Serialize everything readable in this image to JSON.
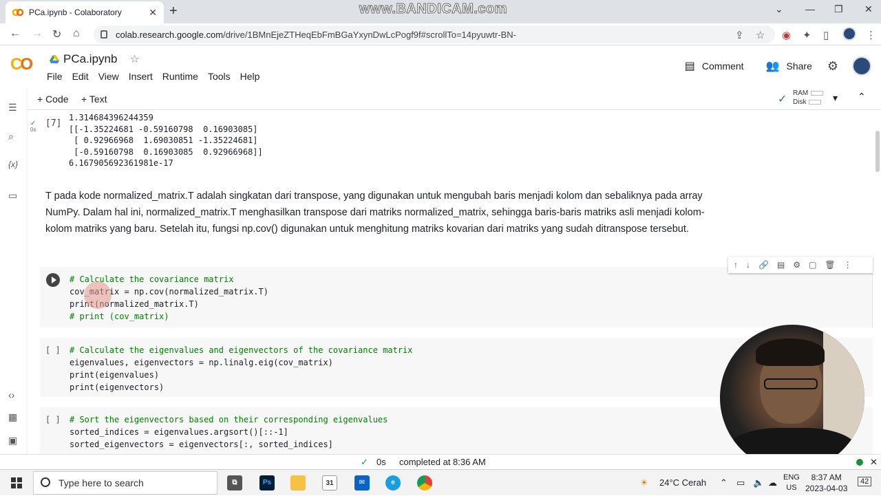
{
  "browser": {
    "tab_title": "PCa.ipynb - Colaboratory",
    "new_tab": "+",
    "url_host": "colab.research.google.com",
    "url_path": "/drive/1BMnEjeZTHeqEbFmBGaYxynDwLcPogf9f#scrollTo=14pyuwtr-BN-",
    "watermark": "www.BANDICAM.com"
  },
  "colab": {
    "logo": "CO",
    "notebook_title": "PCa.ipynb",
    "menu": [
      "File",
      "Edit",
      "View",
      "Insert",
      "Runtime",
      "Tools",
      "Help"
    ],
    "comment_label": "Comment",
    "share_label": "Share",
    "add_code": "+ Code",
    "add_text": "+ Text",
    "ram_label": "RAM",
    "disk_label": "Disk"
  },
  "cells": {
    "output_cell": {
      "exec_count": "[7]",
      "exec_time": "0s",
      "output": "1.314684396244359\n[[-1.35224681 -0.59160798  0.16903085]\n [ 0.92966968  1.69030851 -1.35224681]\n [-0.59160798  0.16903085  0.92966968]]\n6.167905692361981e-17"
    },
    "text_cell": "T pada kode normalized_matrix.T adalah singkatan dari transpose, yang digunakan untuk mengubah baris menjadi kolom dan sebaliknya pada array NumPy. Dalam hal ini, normalized_matrix.T menghasilkan transpose dari matriks normalized_matrix, sehingga baris-baris matriks asli menjadi kolom-kolom matriks yang baru. Setelah itu, fungsi np.cov() digunakan untuk menghitung matriks kovarian dari matriks yang sudah ditranspose tersebut.",
    "active_cell": {
      "line1": "# Calculate the covariance matrix",
      "line2": "cov_matrix = np.cov(normalized_matrix.T)",
      "line3": "print(normalized_matrix.T)",
      "line4": "# print (cov_matrix)"
    },
    "eigen_cell": {
      "bracket": "[ ]",
      "line1": "# Calculate the eigenvalues and eigenvectors of the covariance matrix",
      "line2": "eigenvalues, eigenvectors = np.linalg.eig(cov_matrix)",
      "line3": "print(eigenvalues)",
      "line4": "print(eigenvectors)"
    },
    "sort_cell": {
      "bracket": "[ ]",
      "line1": "# Sort the eigenvectors based on their corresponding eigenvalues",
      "line2": "sorted_indices = eigenvalues.argsort()[::-1]",
      "line3": "sorted_eigenvectors = eigenvectors[:, sorted_indices]"
    }
  },
  "status_bar": {
    "check": "✓",
    "time": "0s",
    "completed": "completed at 8:36 AM"
  },
  "taskbar": {
    "search_placeholder": "Type here to search",
    "weather": "24°C  Cerah",
    "lang": "ENG",
    "region": "US",
    "time": "8:37 AM",
    "date": "2023-04-03",
    "notifications": "42"
  }
}
